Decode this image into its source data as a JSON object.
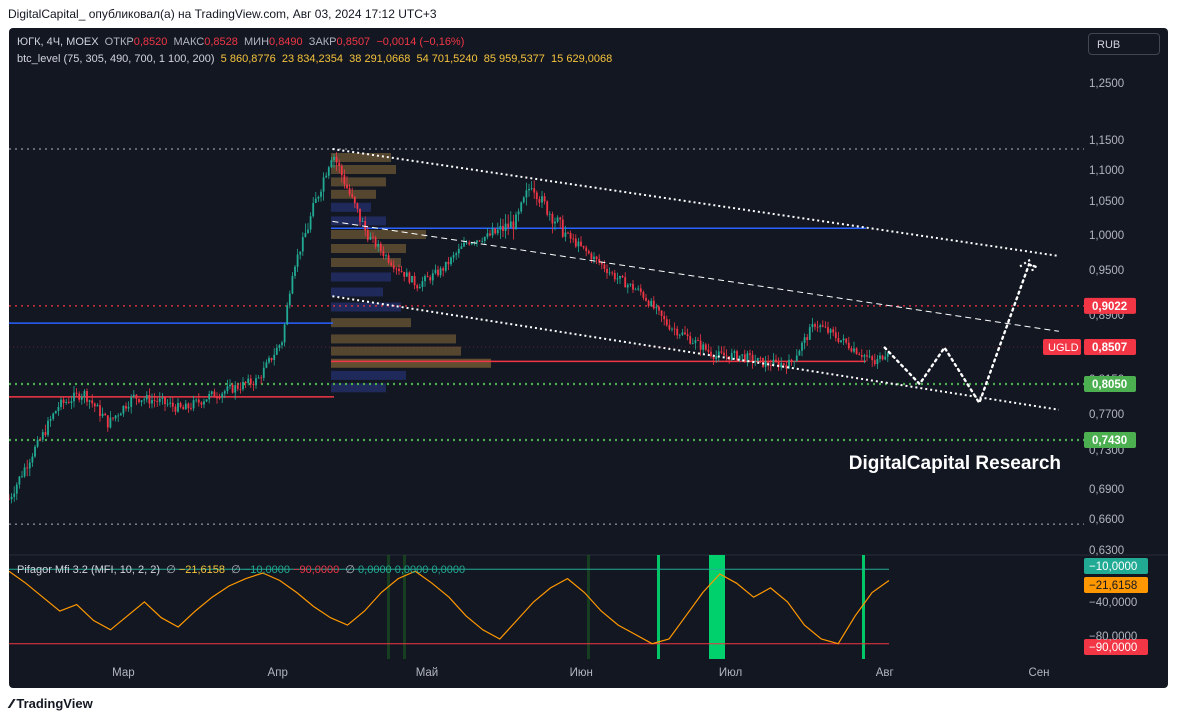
{
  "header": {
    "publisher_text": "DigitalCapital_ опубликовал(а) на TradingView.com, Авг 03, 2024 17:12 UTC+3"
  },
  "footer": {
    "brand": "TradingView"
  },
  "legend": {
    "symbol": "ЮГК, 4Ч, MOEX",
    "open_label": "ОТКР",
    "open_value": "0,8520",
    "high_label": "МАКС",
    "high_value": "0,8528",
    "low_label": "МИН",
    "low_value": "0,8490",
    "close_label": "ЗАКР",
    "close_value": "0,8507",
    "change": "−0,0014 (−0,16%)",
    "indicator_name": "btc_level (75, 305, 490, 700, 1 100, 200)",
    "indicator_values": [
      "5 860,8776",
      "23 834,2354",
      "38 291,0668",
      "54 701,5240",
      "85 959,5377",
      "15 629,0068"
    ]
  },
  "oscillator_legend": {
    "name": "Pifagor Mfi 3.2 (MFI, 10, 2, 2)",
    "sym1": "∅",
    "val1": "−21,6158",
    "sym2": "∅",
    "val2": "−10,0000",
    "val3": "−90,0000",
    "sym3": "∅",
    "val4": "0,0000",
    "val5": "0,0000",
    "val6": "0,0000"
  },
  "currency_button": "RUB",
  "watermark": "DigitalCapital Research",
  "colors": {
    "background": "#131722",
    "up": "#22ab94",
    "down": "#f23645",
    "blue_line": "#2962ff",
    "red_line": "#f23645",
    "green_dotted": "#4caf50",
    "profile": "#2a3a8a",
    "mfi_line": "#ff9800"
  },
  "chart_data": [
    {
      "type": "candlestick",
      "symbol": "ЮГК",
      "exchange": "MOEX",
      "timeframe": "4Ч",
      "currency": "RUB",
      "x_tick_labels": [
        "Мар",
        "Апр",
        "Май",
        "Июн",
        "Июл",
        "Авг",
        "Сен"
      ],
      "y_tick_labels": [
        "1,2500",
        "1,1500",
        "1,1000",
        "1,0500",
        "1,0000",
        "0,9500",
        "0,8900",
        "0,8350",
        "0,8150",
        "0,7700",
        "0,7300",
        "0,6900",
        "0,6600",
        "0,6300"
      ],
      "ylim": [
        0.63,
        1.27
      ],
      "price_tags": [
        {
          "label": "",
          "value": "0,9022",
          "color": "#f23645"
        },
        {
          "label": "UGLD",
          "value": "0,8507",
          "color": "#f23645"
        },
        {
          "label": "",
          "value": "0,8050",
          "color": "#4caf50"
        },
        {
          "label": "",
          "value": "0,7430",
          "color": "#4caf50"
        }
      ],
      "price_path": {
        "x": [
          "2024-02-07",
          "2024-02-12",
          "2024-02-17",
          "2024-02-22",
          "2024-02-27",
          "2024-03-03",
          "2024-03-08",
          "2024-03-13",
          "2024-03-18",
          "2024-03-23",
          "2024-03-28",
          "2024-04-02",
          "2024-04-04",
          "2024-04-07",
          "2024-04-12",
          "2024-04-14",
          "2024-04-16",
          "2024-04-19",
          "2024-04-24",
          "2024-04-29",
          "2024-05-04",
          "2024-05-09",
          "2024-05-14",
          "2024-05-19",
          "2024-05-22",
          "2024-05-24",
          "2024-05-29",
          "2024-06-03",
          "2024-06-08",
          "2024-06-13",
          "2024-06-18",
          "2024-06-23",
          "2024-06-28",
          "2024-07-03",
          "2024-07-08",
          "2024-07-13",
          "2024-07-18",
          "2024-07-23",
          "2024-07-28",
          "2024-07-30",
          "2024-08-02"
        ],
        "y": [
          0.68,
          0.73,
          0.78,
          0.795,
          0.76,
          0.79,
          0.785,
          0.775,
          0.79,
          0.8,
          0.81,
          0.86,
          0.95,
          1.01,
          1.13,
          1.09,
          1.05,
          1.0,
          0.96,
          0.93,
          0.95,
          0.99,
          1.0,
          1.02,
          1.08,
          1.05,
          1.0,
          0.97,
          0.94,
          0.92,
          0.88,
          0.86,
          0.84,
          0.84,
          0.83,
          0.83,
          0.88,
          0.86,
          0.84,
          0.83,
          0.85
        ]
      },
      "levels": [
        {
          "type": "horizontal",
          "value": 1.01,
          "color": "#2962ff"
        },
        {
          "type": "horizontal",
          "value": 0.88,
          "color": "#2962ff"
        },
        {
          "type": "horizontal",
          "value": 0.79,
          "color": "#f23645"
        },
        {
          "type": "horizontal",
          "value": 0.833,
          "color": "#f23645"
        },
        {
          "type": "horizontal",
          "value": 0.9022,
          "color": "#f23645",
          "style": "dotted"
        },
        {
          "type": "horizontal",
          "value": 0.805,
          "color": "#4caf50",
          "style": "dotted"
        },
        {
          "type": "horizontal",
          "value": 0.743,
          "color": "#4caf50",
          "style": "dotted"
        },
        {
          "type": "horizontal",
          "value": 1.135,
          "color": "#b2b5be",
          "style": "dotted"
        },
        {
          "type": "horizontal",
          "value": 0.655,
          "color": "#b2b5be",
          "style": "dotted"
        }
      ],
      "channel_lines": [
        {
          "from": [
            "2024-04-12",
            1.135
          ],
          "to": [
            "2024-09-05",
            0.97
          ],
          "style": "dotted",
          "color": "#ffffff"
        },
        {
          "from": [
            "2024-04-12",
            1.02
          ],
          "to": [
            "2024-09-05",
            0.87
          ],
          "style": "dashed",
          "color": "#ffffff"
        },
        {
          "from": [
            "2024-04-12",
            0.915
          ],
          "to": [
            "2024-09-05",
            0.775
          ],
          "style": "dotted",
          "color": "#ffffff"
        }
      ],
      "forecast_path": {
        "x": [
          "2024-08-01",
          "2024-08-08",
          "2024-08-13",
          "2024-08-20",
          "2024-08-30",
          "2024-09-01"
        ],
        "y": [
          0.85,
          0.805,
          0.85,
          0.783,
          0.958,
          0.953
        ]
      }
    },
    {
      "type": "line",
      "name": "Pifagor Mfi 3.2 (MFI, 10, 2, 2)",
      "ylim": [
        -100,
        0
      ],
      "y_tick_labels": [
        "−10,0000",
        "−21,6158",
        "−40,0000",
        "−80,0000",
        "−90,0000"
      ],
      "levels": [
        -10,
        -90
      ],
      "last_value": -21.6158,
      "values": [
        -12,
        -25,
        -40,
        -55,
        -48,
        -65,
        -75,
        -60,
        -45,
        -62,
        -72,
        -55,
        -40,
        -28,
        -20,
        -14,
        -22,
        -35,
        -50,
        -62,
        -70,
        -55,
        -35,
        -20,
        -12,
        -25,
        -40,
        -60,
        -75,
        -85,
        -65,
        -45,
        -30,
        -20,
        -35,
        -55,
        -70,
        -80,
        -90,
        -85,
        -60,
        -35,
        -15,
        -25,
        -40,
        -30,
        -45,
        -70,
        -85,
        -90,
        -60,
        -35,
        -22
      ]
    }
  ]
}
